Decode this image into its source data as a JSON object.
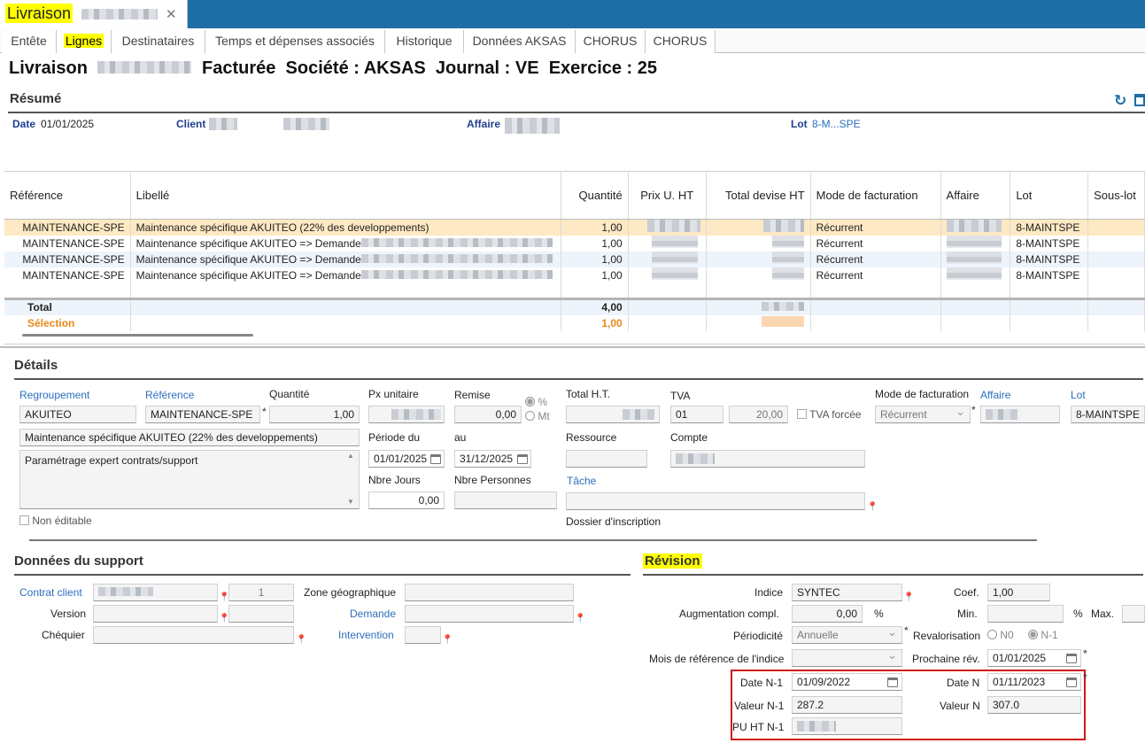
{
  "doc_tab": {
    "title": "Livraison"
  },
  "tabs": [
    "Entête",
    "Lignes",
    "Destinataires",
    "Temps et dépenses associés",
    "Historique",
    "Données AKSAS",
    "CHORUS",
    "CHORUS"
  ],
  "header": {
    "prefix": "Livraison",
    "status": "Facturée",
    "societe_label": "Société :",
    "societe": "AKSAS",
    "journal_label": "Journal :",
    "journal": "VE",
    "exercice_label": "Exercice :",
    "exercice": "25"
  },
  "resume": {
    "title": "Résumé",
    "date_label": "Date",
    "date": "01/01/2025",
    "client_label": "Client",
    "affaire_label": "Affaire",
    "lot_label": "Lot",
    "lot": "8-M...SPE"
  },
  "grid": {
    "columns": [
      "Référence",
      "Libellé",
      "Quantité",
      "Prix U. HT",
      "Total devise HT",
      "Mode de facturation",
      "Affaire",
      "Lot",
      "Sous-lot"
    ],
    "rows": [
      {
        "ref": "MAINTENANCE-SPE",
        "libelle": "Maintenance spécifique AKUITEO (22% des developpements)",
        "qte": "1,00",
        "mode": "Récurrent",
        "lot": "8-MAINTSPE"
      },
      {
        "ref": "MAINTENANCE-SPE",
        "libelle": "Maintenance spécifique AKUITEO => Demande",
        "qte": "1,00",
        "mode": "Récurrent",
        "lot": "8-MAINTSPE"
      },
      {
        "ref": "MAINTENANCE-SPE",
        "libelle": "Maintenance spécifique AKUITEO => Demande",
        "qte": "1,00",
        "mode": "Récurrent",
        "lot": "8-MAINTSPE"
      },
      {
        "ref": "MAINTENANCE-SPE",
        "libelle": "Maintenance spécifique AKUITEO => Demande",
        "qte": "1,00",
        "mode": "Récurrent",
        "lot": "8-MAINTSPE"
      }
    ],
    "total_label": "Total",
    "total_qte": "4,00",
    "selection_label": "Sélection",
    "selection_qte": "1,00"
  },
  "details": {
    "title": "Détails",
    "regroupement_label": "Regroupement",
    "regroupement": "AKUITEO",
    "reference_label": "Référence",
    "reference": "MAINTENANCE-SPE",
    "quantite_label": "Quantité",
    "quantite": "1,00",
    "px_unitaire_label": "Px unitaire",
    "remise_label": "Remise",
    "remise": "0,00",
    "pct_label": "%",
    "mt_label": "Mt",
    "total_ht_label": "Total H.T.",
    "tva_label": "TVA",
    "tva_code": "01",
    "tva_rate": "20,00",
    "tva_forcee_label": "TVA forcée",
    "mode_label": "Mode de facturation",
    "mode": "Récurrent",
    "affaire_label": "Affaire",
    "lot_label": "Lot",
    "lot": "8-MAINTSPE",
    "libelle": "Maintenance spécifique AKUITEO (22% des developpements)",
    "description": "Paramétrage expert contrats/support",
    "periode_du_label": "Période du",
    "periode_du": "01/01/2025",
    "au_label": "au",
    "au": "31/12/2025",
    "ressource_label": "Ressource",
    "compte_label": "Compte",
    "nbre_jours_label": "Nbre Jours",
    "nbre_jours": "0,00",
    "nbre_personnes_label": "Nbre Personnes",
    "tache_label": "Tâche",
    "non_editable_label": "Non éditable",
    "dossier_label": "Dossier d'inscription"
  },
  "support": {
    "title": "Données du support",
    "contrat_label": "Contrat client",
    "contrat_num": "1",
    "version_label": "Version",
    "chequier_label": "Chéquier",
    "zone_label": "Zone géographique",
    "demande_label": "Demande",
    "intervention_label": "Intervention"
  },
  "revision": {
    "title": "Révision",
    "indice_label": "Indice",
    "indice": "SYNTEC",
    "coef_label": "Coef.",
    "coef": "1,00",
    "augmentation_label": "Augmentation compl.",
    "augmentation": "0,00",
    "pct": "%",
    "min_label": "Min.",
    "max_label": "Max.",
    "periodicite_label": "Périodicité",
    "periodicite": "Annuelle",
    "revalorisation_label": "Revalorisation",
    "n0_label": "N0",
    "n1_label": "N-1",
    "mois_ref_label": "Mois de référence de l'indice",
    "prochaine_label": "Prochaine rév.",
    "prochaine": "01/01/2025",
    "date_n1_label": "Date N-1",
    "date_n1": "01/09/2022",
    "date_n_label": "Date N",
    "date_n": "01/11/2023",
    "valeur_n1_label": "Valeur N-1",
    "valeur_n1": "287.2",
    "valeur_n_label": "Valeur N",
    "valeur_n": "307.0",
    "pu_ht_n1_label": "PU HT N-1"
  },
  "colors": {
    "accent": "#1d6fa5",
    "highlight": "#ffff00",
    "selection_row": "#fde9c3",
    "red_frame": "#d01818",
    "orange": "#e8891a"
  },
  "icons": [
    "close-icon",
    "refresh-icon",
    "calendar-icon",
    "pin-icon"
  ]
}
